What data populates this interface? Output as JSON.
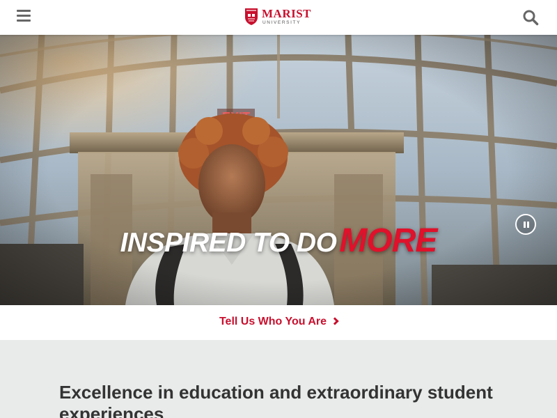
{
  "header": {
    "logo": {
      "name": "MARIST",
      "subtitle": "UNIVERSITY"
    },
    "menu_icon": "hamburger-menu-icon",
    "search_icon": "search-icon"
  },
  "hero": {
    "title_main": "INSPIRED TO DO",
    "title_accent": "MORE",
    "pause_icon": "pause-icon",
    "background_description_hidden": ""
  },
  "cta": {
    "label": "Tell Us Who You Are",
    "icon": "chevron-right-icon"
  },
  "content": {
    "heading": "Excellence in education and extraordinary student experiences"
  },
  "colors": {
    "brand_red": "#c8102e",
    "text_dark": "#333333",
    "page_bg": "#e9ebeb"
  }
}
